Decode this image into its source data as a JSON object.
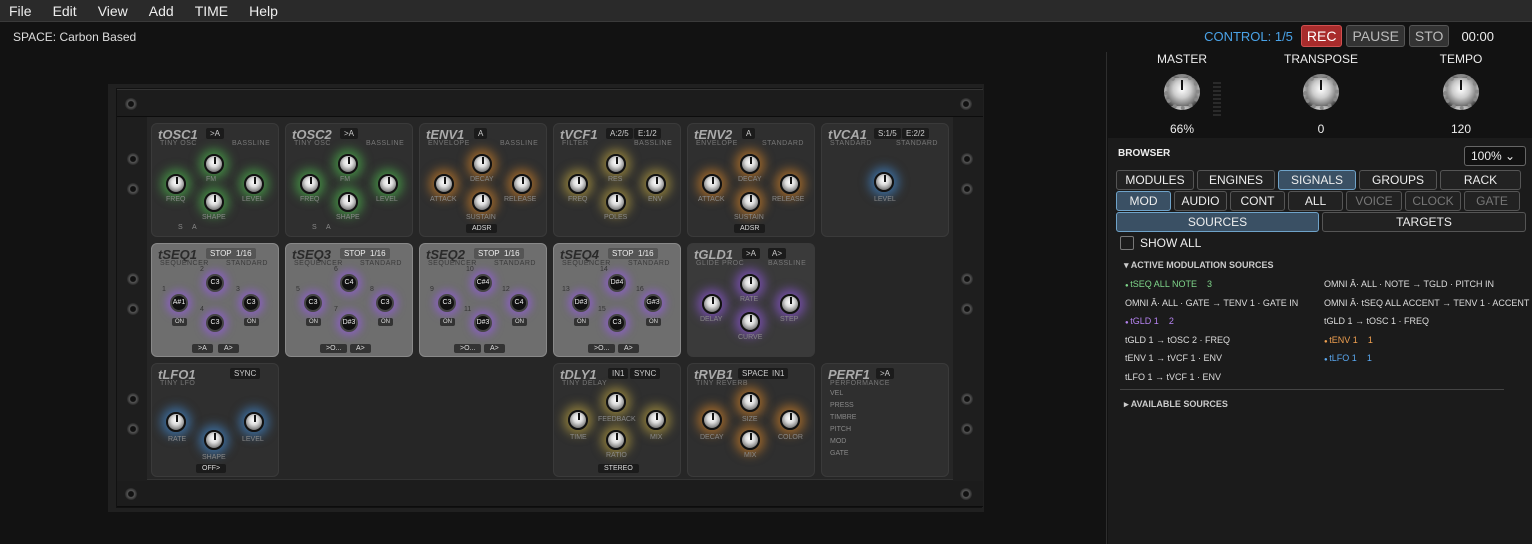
{
  "menu": [
    "File",
    "Edit",
    "View",
    "Add",
    "TIME",
    "Help"
  ],
  "space_label": "SPACE: Carbon Based",
  "transport": {
    "control": "CONTROL: 1/5",
    "rec": "REC",
    "pause": "PAUSE",
    "sto": "STO",
    "clock": "00:00"
  },
  "master": {
    "master_label": "MASTER",
    "master_value": "66%",
    "transpose_label": "TRANSPOSE",
    "transpose_value": "0",
    "tempo_label": "TEMPO",
    "tempo_value": "120"
  },
  "browser": {
    "title": "BROWSER",
    "zoom": "100%",
    "row1": [
      "MODULES",
      "ENGINES",
      "SIGNALS",
      "GROUPS",
      "RACK"
    ],
    "row2": [
      "MOD",
      "AUDIO",
      "CONT",
      "ALL",
      "VOICE",
      "CLOCK",
      "GATE"
    ],
    "row3": [
      "SOURCES",
      "TARGETS"
    ],
    "show_all": "SHOW ALL",
    "active_header": "ACTIVE MODULATION SOURCES",
    "available_header": "AVAILABLE SOURCES",
    "left_lines": [
      {
        "text": "tSEQ ALL NOTE",
        "count": "3",
        "color": "#7fd68a"
      },
      {
        "text": "OMNI Â· ALL  ·  GATE  →  TENV 1 · GATE IN",
        "count": "",
        "color": "#ddd"
      },
      {
        "text": "tGLD 1",
        "count": "2",
        "color": "#b583f0"
      },
      {
        "text": "tGLD 1  →  tOSC 2 · FREQ",
        "count": "",
        "color": "#ddd"
      },
      {
        "text": "tENV 1  →  tVCF 1 · ENV",
        "count": "",
        "color": "#ddd"
      },
      {
        "text": "tLFO 1  →  tVCF 1 · ENV",
        "count": "",
        "color": "#ddd"
      }
    ],
    "right_lines": [
      {
        "text": "OMNI Â· ALL  ·  NOTE  →  TGLD · PITCH IN",
        "count": "",
        "color": "#ddd"
      },
      {
        "text": "OMNI Â· tSEQ ALL ACCENT  →  TENV 1 · ACCENT",
        "count": "",
        "color": "#ddd"
      },
      {
        "text": "tGLD 1  →  tOSC 1 · FREQ",
        "count": "",
        "color": "#ddd"
      },
      {
        "text": "tENV 1",
        "count": "1",
        "color": "#f0a050"
      },
      {
        "text": "tLFO 1",
        "count": "1",
        "color": "#5aa8f0"
      }
    ]
  },
  "modules": {
    "tosc1": {
      "title": "tOSC1",
      "tag": ">A",
      "sub1": "TINY OSC",
      "sub2": "BASSLINE",
      "k1": "FREQ",
      "k2": "FM",
      "k3": "SHAPE",
      "k4": "LEVEL",
      "s": "S",
      "a": "A"
    },
    "tosc2": {
      "title": "tOSC2",
      "tag": ">A",
      "sub1": "TINY OSC",
      "sub2": "BASSLINE",
      "k1": "FREQ",
      "k2": "FM",
      "k3": "SHAPE",
      "k4": "LEVEL",
      "s": "S",
      "a": "A"
    },
    "tenv1": {
      "title": "tENV1",
      "tag": "A",
      "sub1": "ENVELOPE",
      "sub2": "BASSLINE",
      "k1": "ATTACK",
      "k2": "DECAY",
      "k3": "SUSTAIN",
      "k4": "RELEASE",
      "btm": "ADSR"
    },
    "tvcf1": {
      "title": "tVCF1",
      "tag": "A:2/5",
      "tag2": "E:1/2",
      "sub1": "FILTER",
      "sub2": "BASSLINE",
      "k1": "FREQ",
      "k2": "RES",
      "k3": "POLES",
      "k4": "ENV"
    },
    "tenv2": {
      "title": "tENV2",
      "tag": "A",
      "sub1": "ENVELOPE",
      "sub2": "STANDARD",
      "k1": "ATTACK",
      "k2": "DECAY",
      "k3": "SUSTAIN",
      "k4": "RELEASE",
      "btm": "ADSR"
    },
    "tvca1": {
      "title": "tVCA1",
      "tag": "S:1/5",
      "tag2": "E:2/2",
      "sub1": "STANDARD",
      "sub2": "STANDARD",
      "k1": "LEVEL"
    },
    "tseq1": {
      "title": "tSEQ1",
      "tag": "STOP",
      "tag2": "1/16",
      "sub1": "SEQUENCER",
      "sub2": "STANDARD",
      "notes": [
        "A#1",
        "C3",
        "C3",
        "C3"
      ],
      "nums": [
        "1",
        "2",
        "3",
        "4"
      ],
      "on": "ON",
      "b1": ">A",
      "b2": "A>"
    },
    "tseq3": {
      "title": "tSEQ3",
      "tag": "STOP",
      "tag2": "1/16",
      "sub1": "SEQUENCER",
      "sub2": "STANDARD",
      "notes": [
        "C3",
        "C4",
        "D#3",
        "C3"
      ],
      "nums": [
        "5",
        "6",
        "7",
        "8"
      ],
      "on": "ON",
      "b1": ">O...",
      "b2": "A>"
    },
    "tseq2": {
      "title": "tSEQ2",
      "tag": "STOP",
      "tag2": "1/16",
      "sub1": "SEQUENCER",
      "sub2": "STANDARD",
      "notes": [
        "C3",
        "C#4",
        "D#3",
        "C4"
      ],
      "nums": [
        "9",
        "10",
        "11",
        "12"
      ],
      "on": "ON",
      "b1": ">O...",
      "b2": "A>"
    },
    "tseq4": {
      "title": "tSEQ4",
      "tag": "STOP",
      "tag2": "1/16",
      "sub1": "SEQUENCER",
      "sub2": "STANDARD",
      "notes": [
        "D#3",
        "D#4",
        "C3",
        "G#3"
      ],
      "nums": [
        "13",
        "14",
        "15",
        "16"
      ],
      "on": "ON",
      "b1": ">O...",
      "b2": "A>"
    },
    "tgld1": {
      "title": "tGLD1",
      "tag": ">A",
      "tag2": "A>",
      "sub1": "GLIDE PROC",
      "sub2": "BASSLINE",
      "k1": "DELAY",
      "k2": "RATE",
      "k3": "CURVE",
      "k4": "STEP"
    },
    "tlfo1": {
      "title": "tLFO1",
      "tag": "SYNC",
      "sub1": "TINY LFO",
      "k1": "RATE",
      "k2": "SHAPE",
      "k3": "LEVEL",
      "btm": "OFF>"
    },
    "tdly1": {
      "title": "tDLY1",
      "tag": "IN1",
      "tag2": "SYNC",
      "sub1": "TINY DELAY",
      "k1": "TIME",
      "k2": "FEEDBACK",
      "k3": "RATIO",
      "k4": "MIX",
      "btm": "STEREO"
    },
    "trvb1": {
      "title": "tRVB1",
      "tag": "SPACE",
      "tag2": "IN1",
      "sub1": "TINY REVERB",
      "k1": "DECAY",
      "k2": "SIZE",
      "k3": "MIX",
      "k4": "COLOR"
    },
    "tperf1": {
      "title": "PERF1",
      "tag": ">A",
      "sub1": "PERFORMANCE",
      "rows": [
        "VEL",
        "PRESS",
        "TIMBRE",
        "PITCH",
        "MOD",
        "GATE"
      ]
    }
  }
}
